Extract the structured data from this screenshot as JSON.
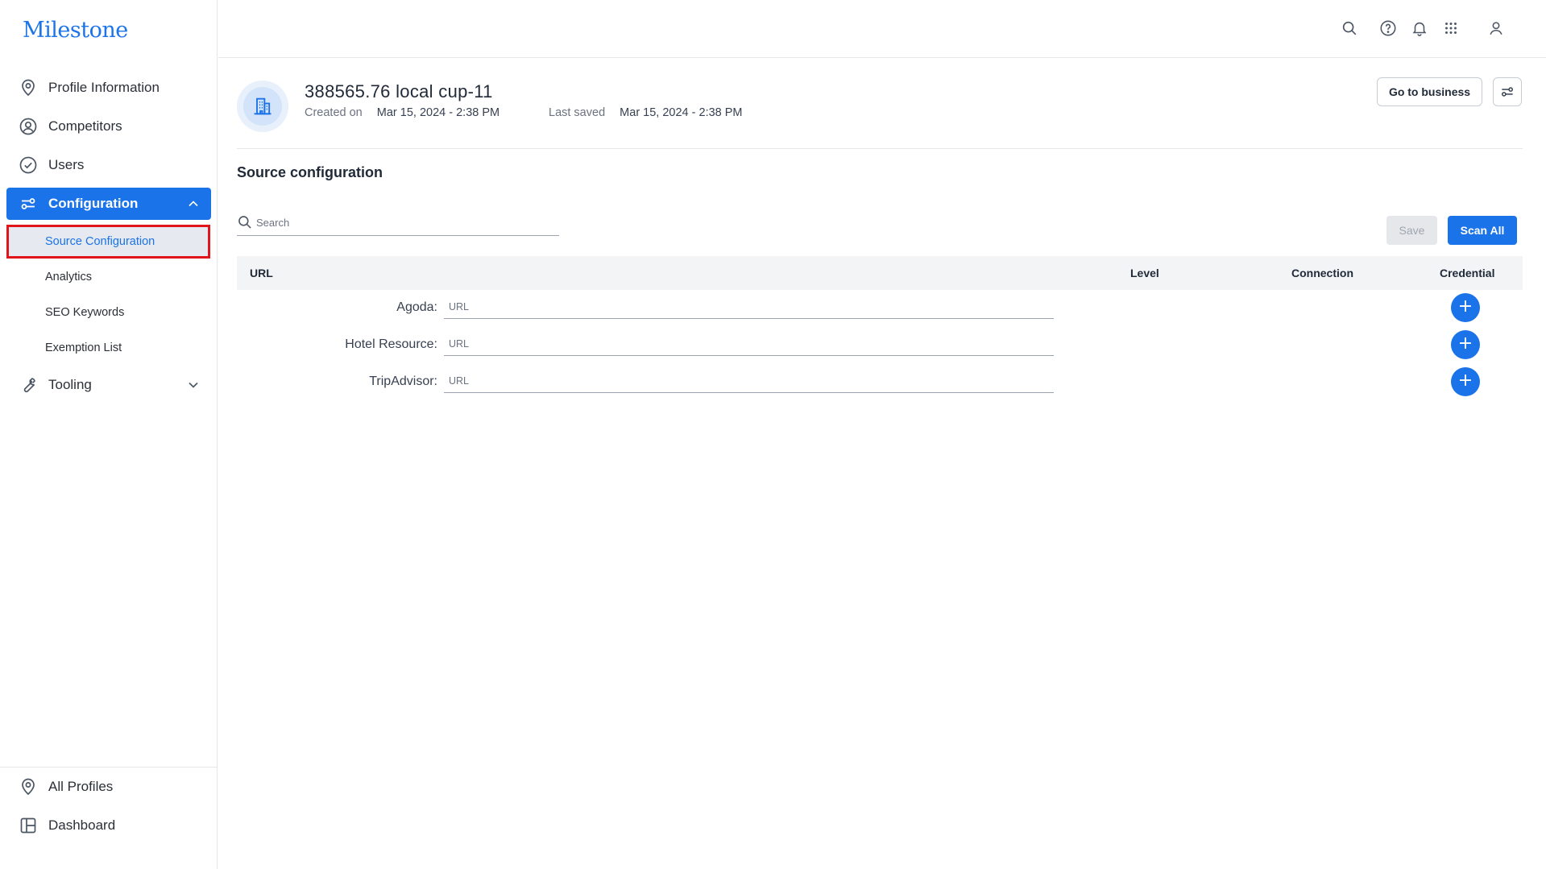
{
  "brand": {
    "logo_text": "Milestone",
    "accent": "#1a73e8",
    "highlight_outline": "#e0141b"
  },
  "sidebar": {
    "items": [
      {
        "label": "Profile Information",
        "icon": "location-pin-icon"
      },
      {
        "label": "Competitors",
        "icon": "user-circle-icon"
      },
      {
        "label": "Users",
        "icon": "check-circle-icon"
      },
      {
        "label": "Configuration",
        "icon": "sliders-icon",
        "active": true,
        "expanded": true
      },
      {
        "label": "Tooling",
        "icon": "wrench-icon",
        "expanded": false
      }
    ],
    "sub_items": [
      {
        "label": "Source Configuration",
        "active": true
      },
      {
        "label": "Analytics"
      },
      {
        "label": "SEO Keywords"
      },
      {
        "label": "Exemption List"
      }
    ],
    "bottom_items": [
      {
        "label": "All Profiles",
        "icon": "location-pin-icon"
      },
      {
        "label": "Dashboard",
        "icon": "dashboard-icon"
      }
    ]
  },
  "topbar": {
    "icons": [
      "search-icon",
      "help-icon",
      "bell-icon",
      "apps-grid-icon",
      "user-icon"
    ]
  },
  "header": {
    "title": "388565.76 local cup-11",
    "created_label": "Created on",
    "created_value": "Mar 15, 2024 - 2:38 PM",
    "saved_label": "Last saved",
    "saved_value": "Mar 15, 2024 - 2:38 PM",
    "go_to_business": "Go to business"
  },
  "main": {
    "section_title": "Source configuration",
    "search_placeholder": "Search",
    "save_label": "Save",
    "scan_all_label": "Scan All",
    "columns": [
      "URL",
      "Level",
      "Connection",
      "Credential"
    ],
    "rows": [
      {
        "label": "Agoda:",
        "placeholder": "URL"
      },
      {
        "label": "Hotel Resource:",
        "placeholder": "URL"
      },
      {
        "label": "TripAdvisor:",
        "placeholder": "URL"
      }
    ],
    "add_symbol": "+"
  }
}
